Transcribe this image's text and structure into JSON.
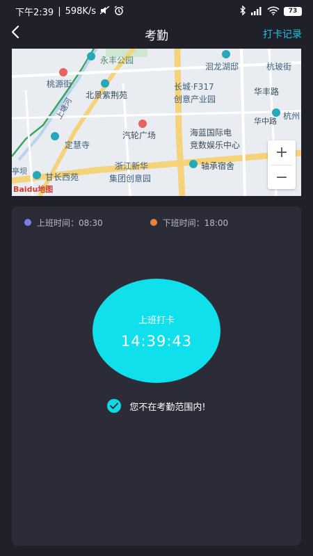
{
  "status_bar": {
    "time": "下午2:39",
    "network_speed": "598K/s",
    "battery": "73"
  },
  "header": {
    "title": "考勤",
    "record_link": "打卡记录"
  },
  "map": {
    "labels": [
      "永丰公园",
      "洄龙湖邸",
      "杭玻街",
      "桃源街",
      "北景紫荆苑",
      "长城·F317",
      "创意产业园",
      "华丰路",
      "杭州",
      "汽轮广场",
      "海蓝国际电",
      "竞数娱乐中心",
      "定慧寺",
      "华中路",
      "浙江新华",
      "集团创意园",
      "轴承宿舍",
      "甘长西苑",
      "上塘河",
      "亭坝"
    ],
    "zoom_in": "+",
    "zoom_out": "−",
    "logo": "Baidu地图"
  },
  "schedule": {
    "start_label": "上班时间：08:30",
    "end_label": "下班时间：18:00",
    "start_color": "#7d7fe8",
    "end_color": "#e6843f"
  },
  "punch": {
    "label": "上班打卡",
    "time": "14:39:43",
    "color": "#10e0eb"
  },
  "range": {
    "message": "您不在考勤范围内!"
  }
}
